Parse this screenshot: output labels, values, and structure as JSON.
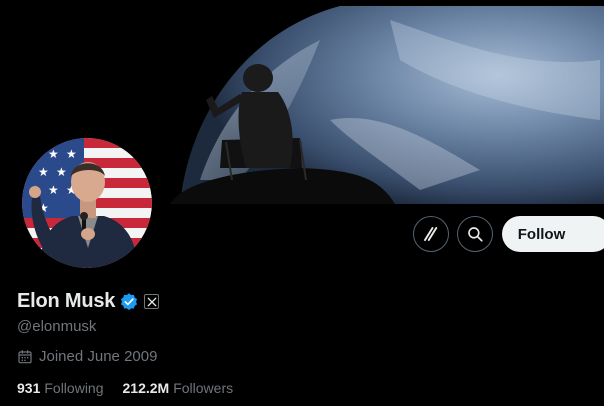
{
  "profile": {
    "display_name": "Elon Musk",
    "handle": "@elonmusk",
    "joined": "Joined June 2009",
    "verified_color": "#1d9bf0"
  },
  "actions": {
    "grok_icon": "grok-icon",
    "search_icon": "search-icon",
    "follow_label": "Follow"
  },
  "stats": {
    "following_count": "931",
    "following_label": "Following",
    "followers_count": "212.2M",
    "followers_label": "Followers"
  },
  "colors": {
    "background": "#000000",
    "text_primary": "#e7e9ea",
    "text_secondary": "#71767b",
    "follow_bg": "#eff3f4"
  }
}
